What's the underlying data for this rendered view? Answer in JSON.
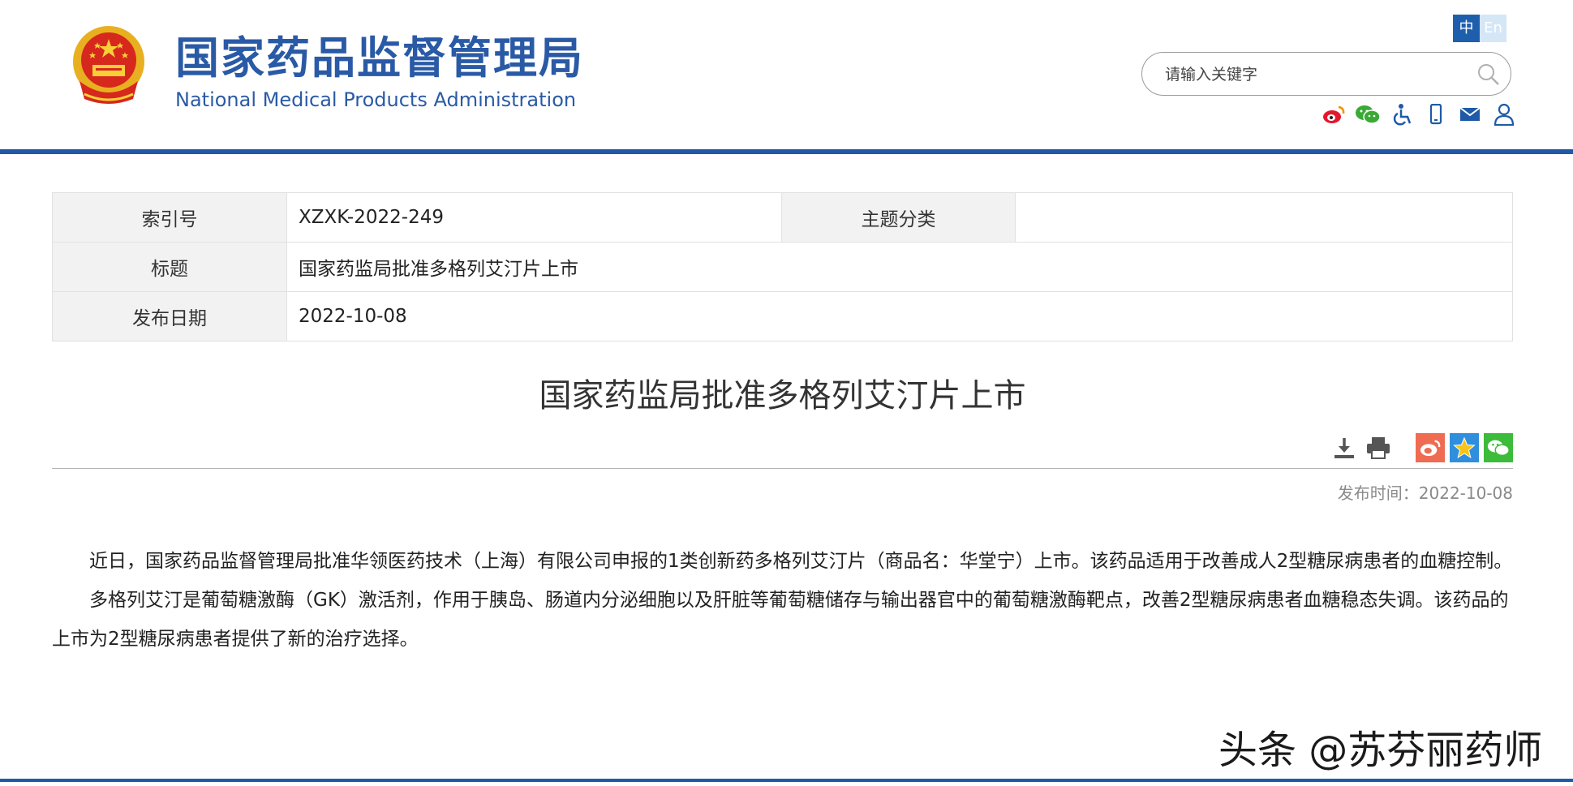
{
  "header": {
    "logo_cn": "国家药品监督管理局",
    "logo_en": "National Medical Products Administration",
    "lang_zh": "中",
    "lang_en": "En",
    "search_placeholder": "请输入关键字",
    "tool_icons": [
      "weibo-icon",
      "wechat-icon",
      "accessibility-icon",
      "mobile-icon",
      "mail-icon",
      "user-icon"
    ],
    "brand_color": "#1e5aa8"
  },
  "meta": {
    "index_label": "索引号",
    "index_value": "XZXK-2022-249",
    "topic_label": "主题分类",
    "topic_value": "",
    "title_label": "标题",
    "title_value": "国家药监局批准多格列艾汀片上市",
    "date_label": "发布日期",
    "date_value": "2022-10-08"
  },
  "article": {
    "title": "国家药监局批准多格列艾汀片上市",
    "publish_time": "发布时间：2022-10-08",
    "paragraphs": [
      "近日，国家药品监督管理局批准华领医药技术（上海）有限公司申报的1类创新药多格列艾汀片（商品名：华堂宁）上市。该药品适用于改善成人2型糖尿病患者的血糖控制。",
      "多格列艾汀是葡萄糖激酶（GK）激活剂，作用于胰岛、肠道内分泌细胞以及肝脏等葡萄糖储存与输出器官中的葡萄糖激酶靶点，改善2型糖尿病患者血糖稳态失调。该药品的上市为2型糖尿病患者提供了新的治疗选择。"
    ],
    "share_icons": [
      "download-icon",
      "print-icon",
      "weibo-share-icon",
      "favorite-icon",
      "wechat-share-icon"
    ]
  },
  "watermark": "头条 @苏芬丽药师"
}
